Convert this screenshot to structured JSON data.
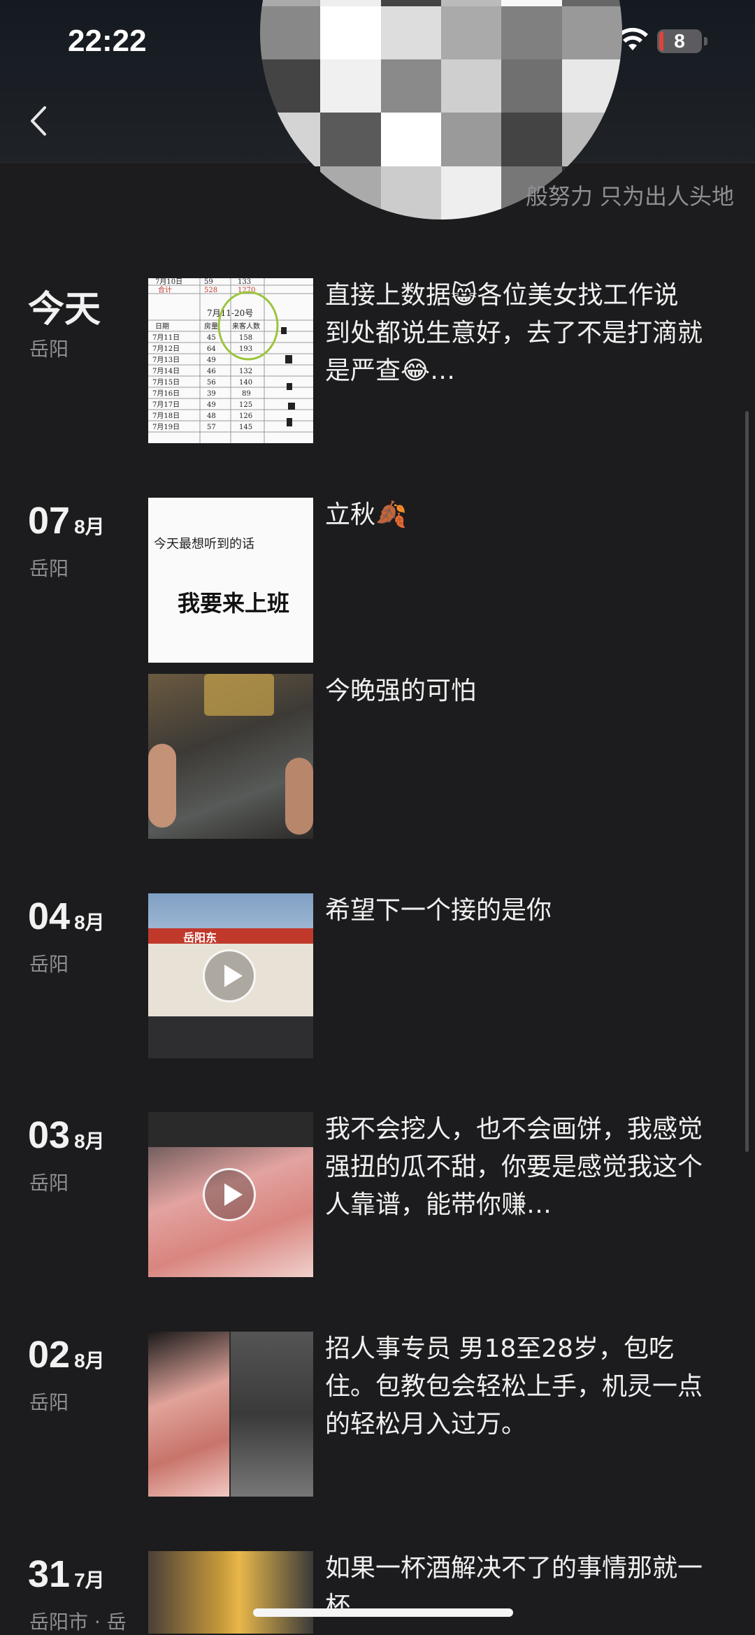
{
  "status_bar": {
    "time": "22:22",
    "battery": "8"
  },
  "profile": {
    "signature": "般努力 只为出人头地"
  },
  "entries": [
    {
      "date": {
        "today": "今天"
      },
      "location": "岳阳",
      "posts": [
        {
          "caption": "直接上数据😸各位美女找工作说到处都说生意好，去了不是打滴就是严查😂…",
          "thumb": {
            "kind": "table",
            "rows": [
              [
                "7月10日",
                "59",
                "133"
              ],
              [
                "合计",
                "528",
                "1270"
              ],
              [
                "7月11-20号",
                "",
                ""
              ],
              [
                "日期",
                "房量",
                "来客人数"
              ],
              [
                "7月11日",
                "45",
                "158"
              ],
              [
                "7月12日",
                "64",
                "193"
              ],
              [
                "7月13日",
                "49",
                ""
              ],
              [
                "7月14日",
                "46",
                "132"
              ],
              [
                "7月15日",
                "56",
                "140"
              ],
              [
                "7月16日",
                "39",
                "89"
              ],
              [
                "7月17日",
                "49",
                "125"
              ],
              [
                "7月18日",
                "48",
                "126"
              ],
              [
                "7月19日",
                "57",
                "145"
              ]
            ]
          }
        }
      ]
    },
    {
      "date": {
        "day": "07",
        "month": "8月"
      },
      "location": "岳阳",
      "posts": [
        {
          "caption": "立秋🍂",
          "thumb": {
            "kind": "text",
            "line1": "今天最想听到的话",
            "line2": "我要来上班"
          }
        },
        {
          "caption": "今晚强的可怕",
          "thumb": {
            "kind": "photo"
          }
        }
      ]
    },
    {
      "date": {
        "day": "04",
        "month": "8月"
      },
      "location": "岳阳",
      "posts": [
        {
          "caption": "希望下一个接的是你",
          "thumb": {
            "kind": "video",
            "sign": "岳阳东"
          }
        }
      ]
    },
    {
      "date": {
        "day": "03",
        "month": "8月"
      },
      "location": "岳阳",
      "posts": [
        {
          "caption": "我不会挖人，也不会画饼，我感觉强扭的瓜不甜，你要是感觉我这个人靠谱，能带你赚…",
          "thumb": {
            "kind": "video"
          }
        }
      ]
    },
    {
      "date": {
        "day": "02",
        "month": "8月"
      },
      "location": "岳阳",
      "posts": [
        {
          "caption": "招人事专员 男18至28岁，包吃住。包教包会轻松上手，机灵一点的轻松月入过万。",
          "thumb": {
            "kind": "photo"
          }
        }
      ]
    },
    {
      "date": {
        "day": "31",
        "month": "7月"
      },
      "location": "岳阳市 · 岳",
      "posts": [
        {
          "caption": "如果一杯酒解决不了的事情那就一杯",
          "thumb": {
            "kind": "photo"
          }
        }
      ]
    }
  ]
}
